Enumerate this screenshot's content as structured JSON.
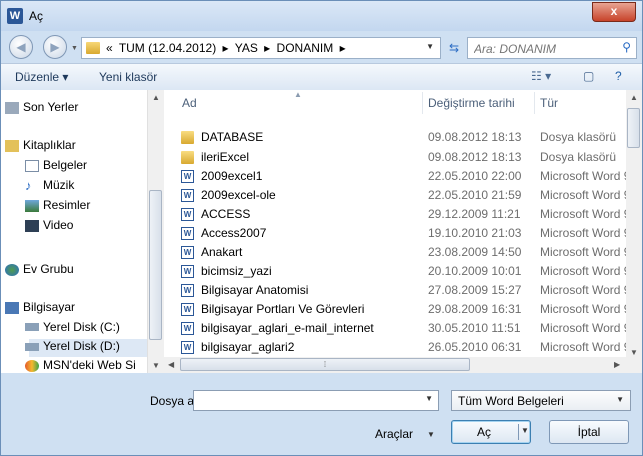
{
  "window": {
    "title": "Aç",
    "app_icon": "W",
    "close_label": "x"
  },
  "navbar": {
    "crumbs": [
      "«",
      "TUM (12.04.2012)",
      "▸",
      "YAS",
      "▸",
      "DONANIM",
      "▸"
    ],
    "search_placeholder": "Ara: DONANIM"
  },
  "toolbar": {
    "organize_label": "Düzenle ▾",
    "new_folder_label": "Yeni klasör"
  },
  "nav_pane": {
    "items": [
      {
        "label": "Son Yerler",
        "icon": "recent-places-icon"
      },
      {
        "label": "Kitaplıklar",
        "icon": "libraries-icon"
      },
      {
        "label": "Belgeler",
        "icon": "documents-icon"
      },
      {
        "label": "Müzik",
        "icon": "music-icon"
      },
      {
        "label": "Resimler",
        "icon": "pictures-icon"
      },
      {
        "label": "Video",
        "icon": "video-icon"
      },
      {
        "label": "Ev Grubu",
        "icon": "homegroup-icon"
      },
      {
        "label": "Bilgisayar",
        "icon": "computer-icon"
      },
      {
        "label": "Yerel Disk (C:)",
        "icon": "disk-icon"
      },
      {
        "label": "Yerel Disk (D:)",
        "icon": "disk-icon",
        "selected": true
      },
      {
        "label": "MSN'deki Web Si",
        "icon": "msn-icon"
      }
    ]
  },
  "list": {
    "columns": {
      "name": "Ad",
      "date": "Değiştirme tarihi",
      "type": "Tür"
    },
    "rows": [
      {
        "name": "DATABASE",
        "date": "09.08.2012 18:13",
        "type": "Dosya klasörü",
        "kind": "folder"
      },
      {
        "name": "ileriExcel",
        "date": "09.08.2012 18:13",
        "type": "Dosya klasörü",
        "kind": "folder"
      },
      {
        "name": "2009excel1",
        "date": "22.05.2010 22:00",
        "type": "Microsoft Word 9",
        "kind": "word"
      },
      {
        "name": "2009excel-ole",
        "date": "22.05.2010 21:59",
        "type": "Microsoft Word 9",
        "kind": "word"
      },
      {
        "name": "ACCESS",
        "date": "29.12.2009 11:21",
        "type": "Microsoft Word 9",
        "kind": "word"
      },
      {
        "name": "Access2007",
        "date": "19.10.2010 21:03",
        "type": "Microsoft Word 9",
        "kind": "word"
      },
      {
        "name": "Anakart",
        "date": "23.08.2009 14:50",
        "type": "Microsoft Word 9",
        "kind": "word"
      },
      {
        "name": "bicimsiz_yazi",
        "date": "20.10.2009 10:01",
        "type": "Microsoft Word 9",
        "kind": "word"
      },
      {
        "name": "Bilgisayar Anatomisi",
        "date": "27.08.2009 15:27",
        "type": "Microsoft Word 9",
        "kind": "word"
      },
      {
        "name": "Bilgisayar Portları Ve Görevleri",
        "date": "29.08.2009 16:31",
        "type": "Microsoft Word 9",
        "kind": "word"
      },
      {
        "name": "bilgisayar_aglari_e-mail_internet",
        "date": "30.05.2010 11:51",
        "type": "Microsoft Word 9",
        "kind": "word"
      },
      {
        "name": "bilgisayar_aglari2",
        "date": "26.05.2010 06:31",
        "type": "Microsoft Word 9",
        "kind": "word"
      }
    ]
  },
  "footer": {
    "filename_label": "Dosya adı:",
    "filename_value": "",
    "filter_value": "Tüm Word Belgeleri",
    "tools_label": "Araçlar",
    "open_label": "Aç",
    "cancel_label": "İptal"
  }
}
